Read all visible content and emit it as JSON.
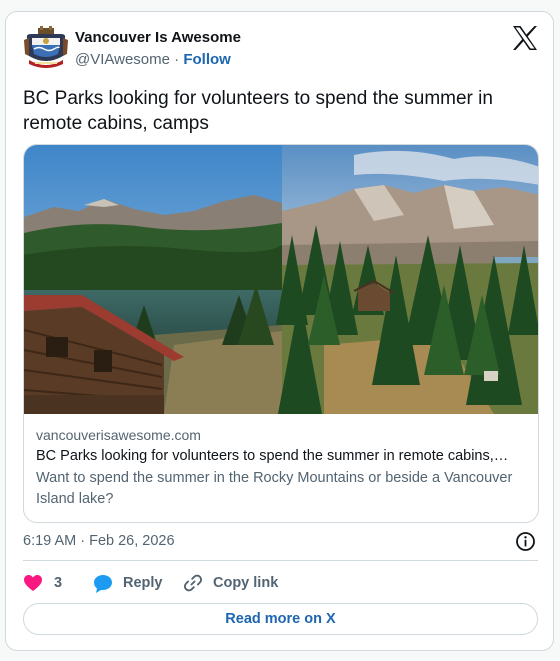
{
  "tweet": {
    "author_name": "Vancouver Is Awesome",
    "handle": "@VIAwesome",
    "separator": "·",
    "follow_label": "Follow",
    "text": "BC Parks looking for volunteers to spend the summer in remote cabins, camps",
    "timestamp": "6:19 AM · Feb 26, 2026"
  },
  "link_card": {
    "domain": "vancouverisawesome.com",
    "title": "BC Parks looking for volunteers to spend the summer in remote cabins,…",
    "description": "Want to spend the summer in the Rocky Mountains or beside a Vancouver Island lake?"
  },
  "actions": {
    "like_count": "3",
    "reply_label": "Reply",
    "copy_label": "Copy link",
    "read_more_label": "Read more on X"
  },
  "colors": {
    "accent": "#1d66b0",
    "like": "#f91880",
    "reply": "#1d9bf0",
    "muted": "#536471",
    "border": "#cfd9de"
  },
  "icons": [
    "avatar-crest",
    "x-logo-icon",
    "info-icon",
    "heart-icon",
    "reply-bubble-icon",
    "link-icon"
  ]
}
